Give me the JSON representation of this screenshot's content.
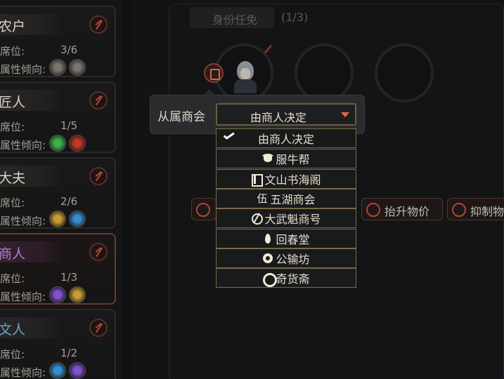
{
  "roles": [
    {
      "name": "农户",
      "seat_label": "席位:",
      "seat_value": "3/6",
      "attr_label": "属性倾向:",
      "attr_colors": [
        "#5a5650",
        "#5a5650"
      ],
      "selected": false
    },
    {
      "name": "匠人",
      "seat_label": "席位:",
      "seat_value": "1/5",
      "attr_label": "属性倾向:",
      "attr_colors": [
        "#2f7d3a",
        "#8c2a22"
      ],
      "selected": false
    },
    {
      "name": "大夫",
      "seat_label": "席位:",
      "seat_value": "2/6",
      "attr_label": "属性倾向:",
      "attr_colors": [
        "#8a7030",
        "#2d6a9a"
      ],
      "selected": false
    },
    {
      "name": "商人",
      "seat_label": "席位:",
      "seat_value": "1/3",
      "attr_label": "属性倾向:",
      "attr_colors": [
        "#5a3a9a",
        "#8a7030"
      ],
      "selected": true
    },
    {
      "name": "文人",
      "seat_label": "席位:",
      "seat_value": "1/2",
      "attr_label": "属性倾向:",
      "attr_colors": [
        "#2d6a9a",
        "#5a3a9a"
      ],
      "selected": false
    }
  ],
  "header": {
    "tab_label": "身份任免",
    "tab_count": "(1/3)"
  },
  "actions": [
    {
      "label": ""
    },
    {
      "label": "抬升物价"
    },
    {
      "label": "抑制物价"
    }
  ],
  "popup": {
    "label": "从属商会",
    "selected_value": "由商人决定",
    "options": [
      {
        "label": "由商人决定",
        "icon": "check-icon",
        "checked": true
      },
      {
        "label": "服牛帮",
        "icon": "bull-icon",
        "checked": false
      },
      {
        "label": "文山书海阁",
        "icon": "book-icon",
        "checked": false
      },
      {
        "label": "五湖商会",
        "icon": "five-icon",
        "icon_text": "伍",
        "checked": false
      },
      {
        "label": "大武魁商号",
        "icon": "swirl-icon",
        "checked": false
      },
      {
        "label": "回春堂",
        "icon": "leaf-icon",
        "checked": false
      },
      {
        "label": "公输坊",
        "icon": "gear-icon",
        "checked": false
      },
      {
        "label": "奇货斋",
        "icon": "ring-icon",
        "checked": false
      }
    ]
  },
  "colors": {
    "accent": "#e8684a",
    "selected_role_title": "#a985c8",
    "dropdown_border": "#7a6a4a"
  }
}
